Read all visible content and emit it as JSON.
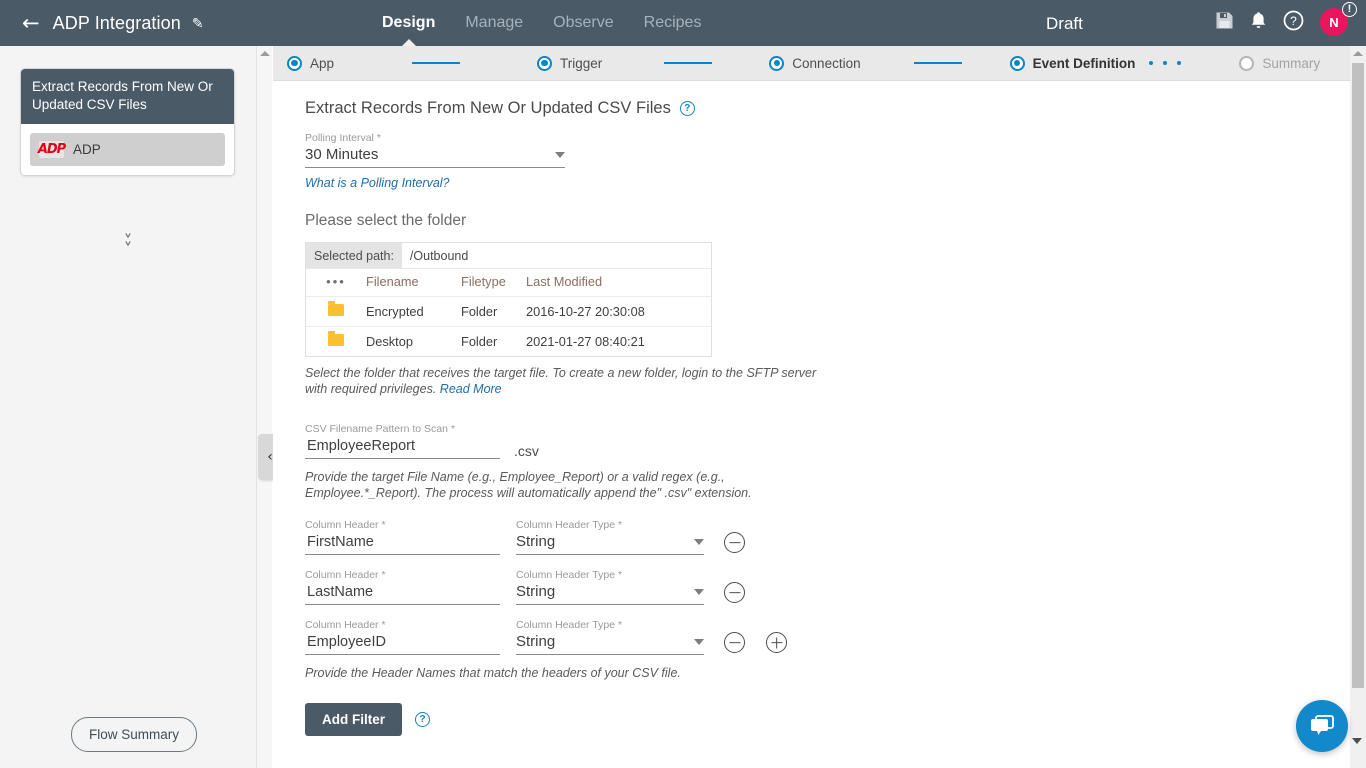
{
  "header": {
    "back_icon": "back-arrow-icon",
    "flow_title": "ADP Integration",
    "edit_icon": "pencil-icon",
    "nav_tabs": [
      {
        "label": "Design",
        "active": true
      },
      {
        "label": "Manage",
        "active": false
      },
      {
        "label": "Observe",
        "active": false
      },
      {
        "label": "Recipes",
        "active": false
      }
    ],
    "status": "Draft",
    "icons": [
      "save-icon",
      "bell-icon",
      "help-icon"
    ],
    "avatar_initial": "N",
    "avatar_badge": "!",
    "avatar_color": "#e8175d",
    "bar_color": "#4a5a67"
  },
  "sidebar": {
    "card_title": "Extract Records From New Or Updated CSV Files",
    "app_name": "ADP",
    "app_logo": "adp-logo",
    "app_logo_text": "ADP",
    "app_logo_color": "#e2001a",
    "expand_icon": "double-chevron-down-icon",
    "flow_summary_label": "Flow Summary"
  },
  "stepper": {
    "steps": [
      {
        "label": "App",
        "state": "complete"
      },
      {
        "label": "Trigger",
        "state": "complete"
      },
      {
        "label": "Connection",
        "state": "complete"
      },
      {
        "label": "Event Definition",
        "state": "current"
      },
      {
        "label": "Summary",
        "state": "pending"
      }
    ],
    "accent_color": "#0b83c9"
  },
  "main": {
    "section_title": "Extract Records From New Or Updated CSV Files",
    "section_help_icon": "help-icon",
    "polling": {
      "label": "Polling Interval *",
      "value": "30 Minutes",
      "link": "What is a Polling Interval?"
    },
    "folder_section": {
      "title": "Please select the folder",
      "selected_path_label": "Selected path:",
      "selected_path_value": "/Outbound",
      "columns": [
        "•••",
        "Filename",
        "Filetype",
        "Last Modified"
      ],
      "rows": [
        {
          "icon": "folder-icon",
          "filename": "Encrypted",
          "filetype": "Folder",
          "modified": "2016-10-27 20:30:08"
        },
        {
          "icon": "folder-icon",
          "filename": "Desktop",
          "filetype": "Folder",
          "modified": "2021-01-27 08:40:21"
        }
      ],
      "hint_text": "Select the folder that receives the target file. To create a new folder, login to the SFTP server with required privileges.",
      "hint_link": "Read More"
    },
    "csv_pattern": {
      "label": "CSV Filename Pattern to Scan *",
      "value": "EmployeeReport",
      "placeholder": "",
      "extension": ".csv",
      "hint": "Provide the target File Name (e.g., Employee_Report) or a valid regex (e.g., Employee.*_Report). The process will automatically append the\" .csv\" extension."
    },
    "column_headers": {
      "name_label": "Column Header *",
      "type_label": "Column Header Type *",
      "rows": [
        {
          "name": "FirstName",
          "type": "String",
          "has_remove": true,
          "has_add": false
        },
        {
          "name": "LastName",
          "type": "String",
          "has_remove": true,
          "has_add": false
        },
        {
          "name": "EmployeeID",
          "type": "String",
          "has_remove": true,
          "has_add": true
        }
      ],
      "hint": "Provide the Header Names that match the headers of your CSV file."
    },
    "add_filter": {
      "label": "Add Filter",
      "help_icon": "help-icon"
    }
  },
  "chat": {
    "icon": "chat-bubble-icon",
    "collapse_icon": "chevron-down-icon",
    "color": "#1289ca"
  }
}
